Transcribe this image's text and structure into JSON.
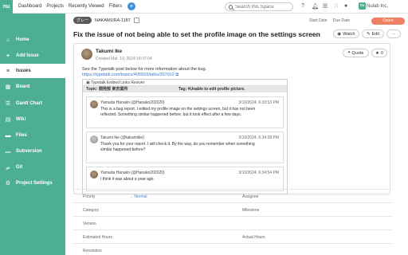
{
  "topbar": {
    "logo": "nu",
    "nav": [
      "Dashboard",
      "Projects",
      "Recently Viewed",
      "Filters"
    ],
    "plus": "+",
    "search_placeholder": "Search this Space",
    "org": "Nulab Inc.",
    "org_logo": "nu"
  },
  "sidebar": {
    "items": [
      {
        "label": "Home",
        "icon": "⌂"
      },
      {
        "label": "Add Issue",
        "icon": "+"
      },
      {
        "label": "Issues",
        "icon": "≡"
      },
      {
        "label": "Board",
        "icon": "▦"
      },
      {
        "label": "Gantt Chart",
        "icon": "☰"
      },
      {
        "label": "Wiki",
        "icon": "▤"
      },
      {
        "label": "Files",
        "icon": "▬"
      },
      {
        "label": "Subversion",
        "icon": "svn"
      },
      {
        "label": "Git",
        "icon": "git"
      },
      {
        "label": "Project Settings",
        "icon": "⚙"
      }
    ],
    "active_index": 2
  },
  "issue": {
    "tag": "グレー",
    "key": "NAKAMURA-1187",
    "start_date_label": "Start Date",
    "due_date_label": "Due Date",
    "status": "Open",
    "title": "Fix the issue of not being able to set the profile image on the settings screen",
    "watch_label": "Watch",
    "edit_label": "Edit",
    "more_label": "···"
  },
  "post": {
    "author": "Takumi Ike",
    "created": "Created  Mar. 10, 2024 18:37:04",
    "quote_label": "Quote",
    "star_count": "0",
    "description": "See the Typetalk post below for more information about the bug.",
    "link": "https://typetalk.com/topics/406593/talks/307912",
    "embed": {
      "header": "Typetalk Embed Links Reviver",
      "topic": "Topic: 開発部 東京業所",
      "tag": "Tag: #Unable to edit profile picture.",
      "messages": [
        {
          "name": "Yamada Hanako (@Hanako202020)",
          "date": "3/10/2024, 6:33:53 PM",
          "body": "This is a bug report. I edited my profile image on the settings screen, but it has not been reflected. Something similar happened before, but it took effect after a few days."
        },
        {
          "name": "Takumi Ike (@takumiike)",
          "date": "3/10/2024, 6:34:28 PM",
          "body": "Thank you for your report. I will check it. By the way, do you remember when something similar happened before?"
        },
        {
          "name": "Yamada Hanako (@Hanako202020)",
          "date": "3/10/2024, 6:34:54 PM",
          "body": "I think it was about a year ago."
        }
      ]
    }
  },
  "fields": [
    {
      "left_label": "Priority",
      "left_value": "→  Normal",
      "right_label": "Assignee",
      "right_value": ""
    },
    {
      "left_label": "Category",
      "left_value": "",
      "right_label": "Milestone",
      "right_value": ""
    },
    {
      "left_label": "Version",
      "left_value": "",
      "right_label": "",
      "right_value": ""
    },
    {
      "left_label": "Estimated Hours",
      "left_value": "",
      "right_label": "Actual Hours",
      "right_value": ""
    },
    {
      "left_label": "Resolution",
      "left_value": "",
      "right_label": "",
      "right_value": ""
    }
  ],
  "colors": {
    "brand": "#4caf93",
    "status_open": "#ed7f63",
    "link": "#3c7bc8"
  }
}
